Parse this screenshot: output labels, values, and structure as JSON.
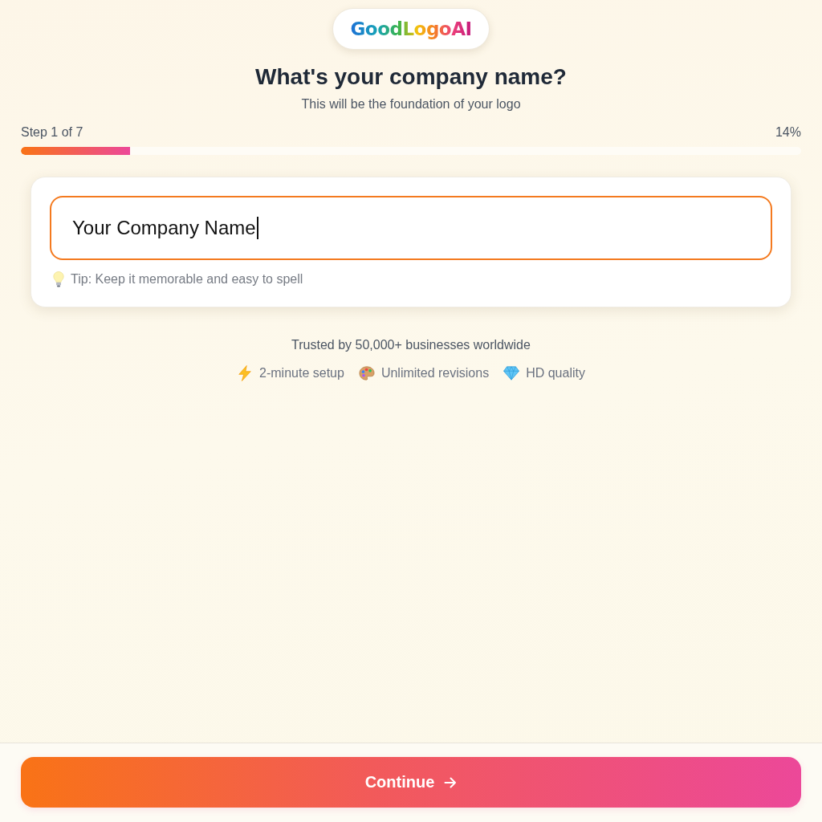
{
  "logo": {
    "text": "GoodLogoAI"
  },
  "heading": {
    "title": "What's your company name?",
    "subtitle": "This will be the foundation of your logo"
  },
  "progress": {
    "step_label": "Step 1 of 7",
    "percent": "14%",
    "level": 0.14
  },
  "name_field": {
    "value": "Your Company Name",
    "focused": true,
    "tip": "Tip: Keep it memorable and easy to spell"
  },
  "trust": {
    "text": "Trusted by 50,000+ businesses worldwide",
    "features": [
      {
        "kind": "bolt",
        "label": "2-minute setup"
      },
      {
        "kind": "palette",
        "label": "Unlimited revisions"
      },
      {
        "kind": "gem",
        "label": "HD quality"
      }
    ]
  },
  "footer": {
    "button": "Continue"
  }
}
